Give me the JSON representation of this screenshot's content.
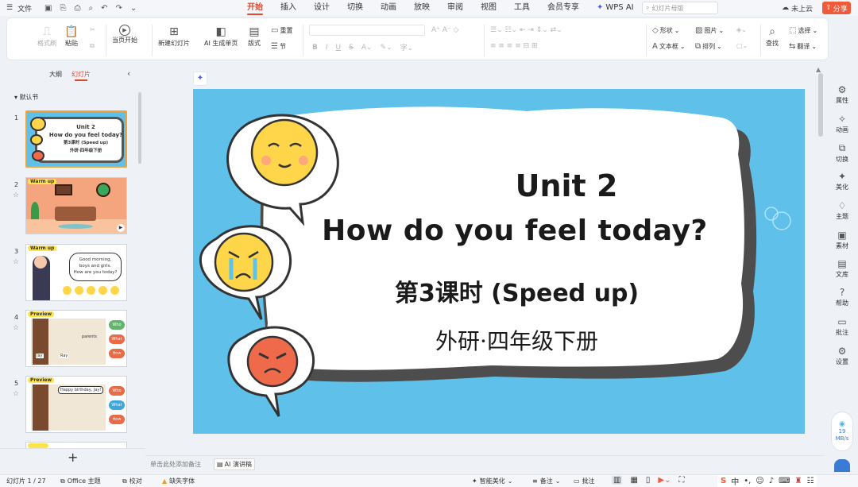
{
  "topbar": {
    "menu_label": "文件",
    "tabs": [
      "开始",
      "插入",
      "设计",
      "切换",
      "动画",
      "放映",
      "审阅",
      "视图",
      "工具",
      "会员专享",
      "WPS AI"
    ],
    "search_placeholder": "幻灯片母版",
    "cloud_label": "未上云",
    "share_label": "分享"
  },
  "ribbon": {
    "format_painter": "格式刷",
    "paste": "粘贴",
    "start_from_current": "当页开始",
    "new_slide": "新建幻灯片",
    "ai_single_page": "AI 生成单页",
    "layout": "版式",
    "reset": "重置",
    "section": "节",
    "shape": "形状",
    "image": "图片",
    "textbox": "文本框",
    "arrange": "排列",
    "find": "查找",
    "select": "选择",
    "translate": "翻译"
  },
  "left_pane": {
    "tab_outline": "大纲",
    "tab_slides": "幻灯片",
    "section_name": "默认节",
    "add_label": "+",
    "thumbs": [
      {
        "num": "1",
        "title": "Unit 2",
        "sub": "How do you feel today?",
        "sub2": "第3课时 (Speed up)",
        "sub3": "外研·四年级下册"
      },
      {
        "num": "2",
        "tag": "Warm up"
      },
      {
        "num": "3",
        "tag": "Warm up",
        "bubble1": "Good morning,",
        "bubble2": "boys and girls.",
        "bubble3": "How are you today?"
      },
      {
        "num": "4",
        "tag": "Preview",
        "w1": "Who",
        "w2": "What",
        "w3": "How",
        "label_parents": "parents",
        "label_jay": "Jay",
        "label_ray": "Ray"
      },
      {
        "num": "5",
        "tag": "Preview",
        "bubble": "Happy birthday, Jay!",
        "w1": "Who",
        "w2": "What",
        "w3": "How"
      }
    ]
  },
  "slide": {
    "title": "Unit 2",
    "subtitle": "How do you feel today?",
    "lesson": "第3课时 (Speed up)",
    "book": "外研·四年级下册"
  },
  "right_bar": [
    "属性",
    "动画",
    "切换",
    "美化",
    "主题",
    "素材",
    "文库",
    "帮助",
    "批注",
    "设置"
  ],
  "network": {
    "value": "19",
    "unit": "MB/s"
  },
  "notes": {
    "placeholder": "单击此处添加备注",
    "ai_script": "AI 演讲稿"
  },
  "status": {
    "slide_count": "幻灯片 1 / 27",
    "theme": "Office 主题",
    "proofread": "校对",
    "missing_font": "缺失字体",
    "smart_beautify": "智能美化",
    "notes": "备注",
    "comments": "批注"
  },
  "colors": {
    "accent": "#e0492e",
    "slide_bg": "#5fc0ea"
  }
}
